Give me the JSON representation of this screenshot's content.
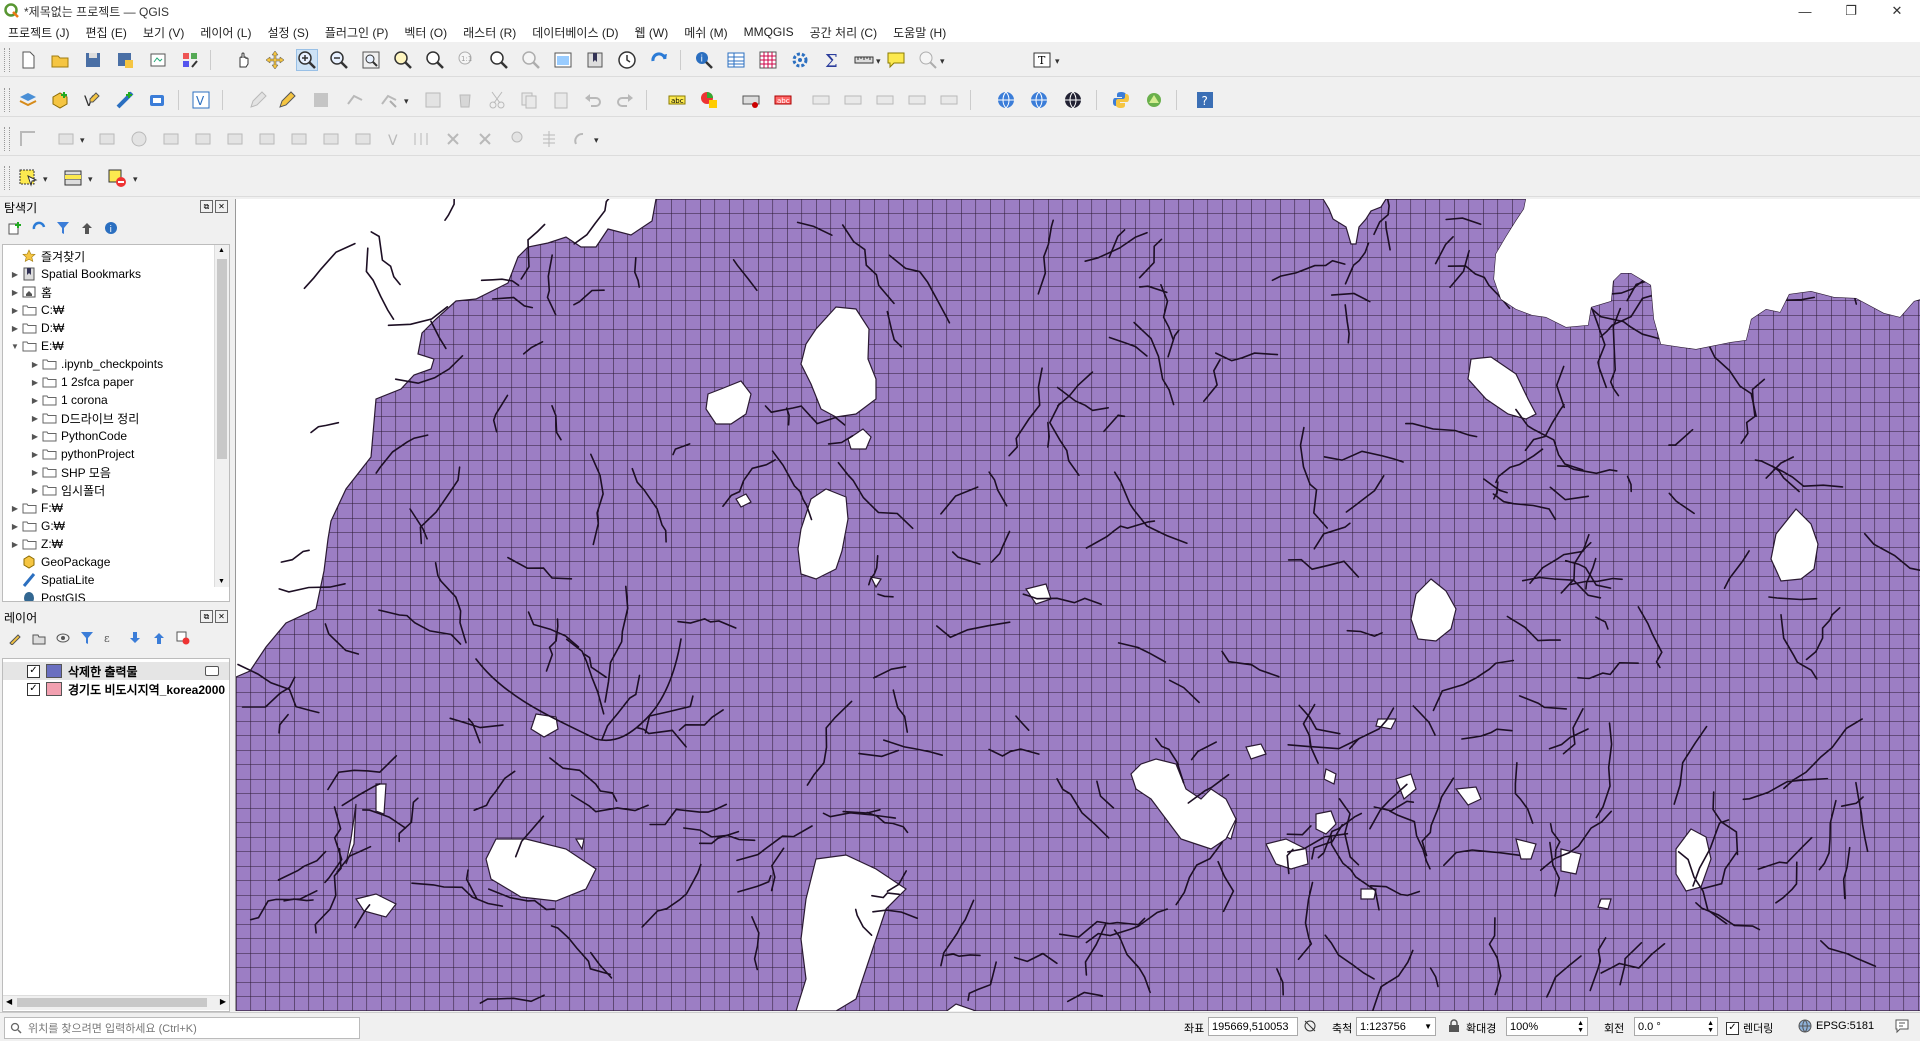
{
  "window": {
    "title": "*제목없는 프로젝트 — QGIS",
    "minimize": "—",
    "restore": "❐",
    "close": "✕"
  },
  "menu": [
    "프로젝트 (J)",
    "편집 (E)",
    "보기 (V)",
    "레이어 (L)",
    "설정 (S)",
    "플러그인 (P)",
    "벡터 (O)",
    "래스터 (R)",
    "데이터베이스 (D)",
    "웹 (W)",
    "메쉬 (M)",
    "MMQGIS",
    "공간 처리 (C)",
    "도움말 (H)"
  ],
  "browser": {
    "title": "탐색기",
    "items": [
      {
        "label": "즐겨찾기",
        "icon": "star-icon",
        "level": 0,
        "arrow": ""
      },
      {
        "label": "Spatial Bookmarks",
        "icon": "bookmark-icon",
        "level": 0,
        "arrow": "▶"
      },
      {
        "label": "홈",
        "icon": "home-icon",
        "level": 0,
        "arrow": "▶"
      },
      {
        "label": "C:₩",
        "icon": "folder-icon",
        "level": 0,
        "arrow": "▶"
      },
      {
        "label": "D:₩",
        "icon": "folder-icon",
        "level": 0,
        "arrow": "▶"
      },
      {
        "label": "E:₩",
        "icon": "folder-icon",
        "level": 0,
        "arrow": "▼"
      },
      {
        "label": ".ipynb_checkpoints",
        "icon": "folder-icon",
        "level": 1,
        "arrow": "▶"
      },
      {
        "label": "1 2sfca paper",
        "icon": "folder-icon",
        "level": 1,
        "arrow": "▶"
      },
      {
        "label": "1 corona",
        "icon": "folder-icon",
        "level": 1,
        "arrow": "▶"
      },
      {
        "label": "D드라이브 정리",
        "icon": "folder-icon",
        "level": 1,
        "arrow": "▶"
      },
      {
        "label": "PythonCode",
        "icon": "folder-icon",
        "level": 1,
        "arrow": "▶"
      },
      {
        "label": "pythonProject",
        "icon": "folder-icon",
        "level": 1,
        "arrow": "▶"
      },
      {
        "label": "SHP 모음",
        "icon": "folder-icon",
        "level": 1,
        "arrow": "▶"
      },
      {
        "label": "임시폴더",
        "icon": "folder-icon",
        "level": 1,
        "arrow": "▶"
      },
      {
        "label": "F:₩",
        "icon": "folder-icon",
        "level": 0,
        "arrow": "▶"
      },
      {
        "label": "G:₩",
        "icon": "folder-icon",
        "level": 0,
        "arrow": "▶"
      },
      {
        "label": "Z:₩",
        "icon": "folder-icon",
        "level": 0,
        "arrow": "▶"
      },
      {
        "label": "GeoPackage",
        "icon": "geopackage-icon",
        "level": 0,
        "arrow": ""
      },
      {
        "label": "SpatiaLite",
        "icon": "spatialite-icon",
        "level": 0,
        "arrow": ""
      },
      {
        "label": "PostGIS",
        "icon": "postgis-icon",
        "level": 0,
        "arrow": ""
      }
    ]
  },
  "layers": {
    "title": "레이어",
    "items": [
      {
        "label": "삭제한 출력물",
        "color": "#6a6fc0",
        "checked": true,
        "bold": true
      },
      {
        "label": "경기도 비도시지역_korea2000",
        "color": "#f2a0b0",
        "checked": true,
        "bold": true
      }
    ]
  },
  "map": {
    "fill": "#9c7ec4",
    "grid_color": "#2b1a33"
  },
  "status": {
    "locator_placeholder": "위치를 찾으려면 입력하세요 (Ctrl+K)",
    "coord_label": "좌표",
    "coord_value": "195669,510053",
    "scale_label": "축척",
    "scale_value": "1:123756",
    "magnifier_label": "확대경",
    "magnifier_value": "100%",
    "rotation_label": "회전",
    "rotation_value": "0.0 °",
    "render_label": "렌더링",
    "crs_value": "EPSG:5181"
  }
}
